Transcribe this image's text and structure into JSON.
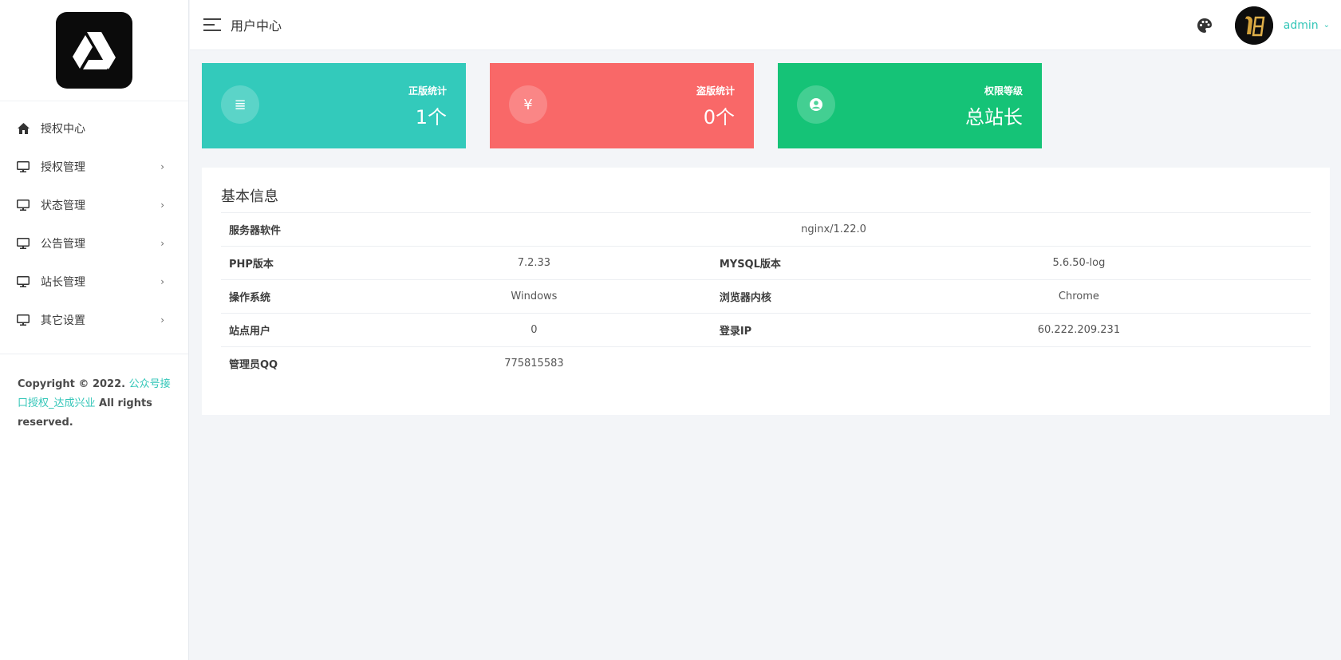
{
  "sidebar": {
    "logo_icon": "drive-triangle-logo",
    "items": [
      {
        "label": "授权中心",
        "icon": "home-icon",
        "has_submenu": false
      },
      {
        "label": "授权管理",
        "icon": "monitor-icon",
        "has_submenu": true
      },
      {
        "label": "状态管理",
        "icon": "monitor-icon",
        "has_submenu": true
      },
      {
        "label": "公告管理",
        "icon": "monitor-icon",
        "has_submenu": true
      },
      {
        "label": "站长管理",
        "icon": "monitor-icon",
        "has_submenu": true
      },
      {
        "label": "其它设置",
        "icon": "monitor-icon",
        "has_submenu": true
      }
    ],
    "chevron": "›",
    "copyright": {
      "prefix": "Copyright © 2022. ",
      "link": "公众号接口授权_达成兴业",
      "suffix": " All rights reserved."
    }
  },
  "header": {
    "title": "用户中心",
    "user_name": "admin",
    "caret": "⌄"
  },
  "cards": [
    {
      "label": "正版统计",
      "value": "1个",
      "icon": "list-icon",
      "glyph": "≣",
      "color": "#33cabb"
    },
    {
      "label": "盗版统计",
      "value": "0个",
      "icon": "yen-icon",
      "glyph": "¥",
      "color": "#f96868"
    },
    {
      "label": "权限等级",
      "value": "总站长",
      "icon": "user-circle-icon",
      "glyph": "",
      "color": "#15c377"
    }
  ],
  "info": {
    "title": "基本信息",
    "server_software": {
      "key": "服务器软件",
      "value": "nginx/1.22.0"
    },
    "php_version": {
      "key": "PHP版本",
      "value": "7.2.33"
    },
    "mysql_version": {
      "key": "MYSQL版本",
      "value": "5.6.50-log"
    },
    "os": {
      "key": "操作系统",
      "value": "Windows"
    },
    "browser": {
      "key": "浏览器内核",
      "value": "Chrome"
    },
    "site_users": {
      "key": "站点用户",
      "value": "0"
    },
    "login_ip": {
      "key": "登录IP",
      "value": "60.222.209.231"
    },
    "admin_qq": {
      "key": "管理员QQ",
      "value": "775815583"
    }
  },
  "colors": {
    "accent": "#33c6b8",
    "card_teal": "#33cabb",
    "card_red": "#f96868",
    "card_green": "#15c377",
    "background": "#f3f5f8"
  }
}
